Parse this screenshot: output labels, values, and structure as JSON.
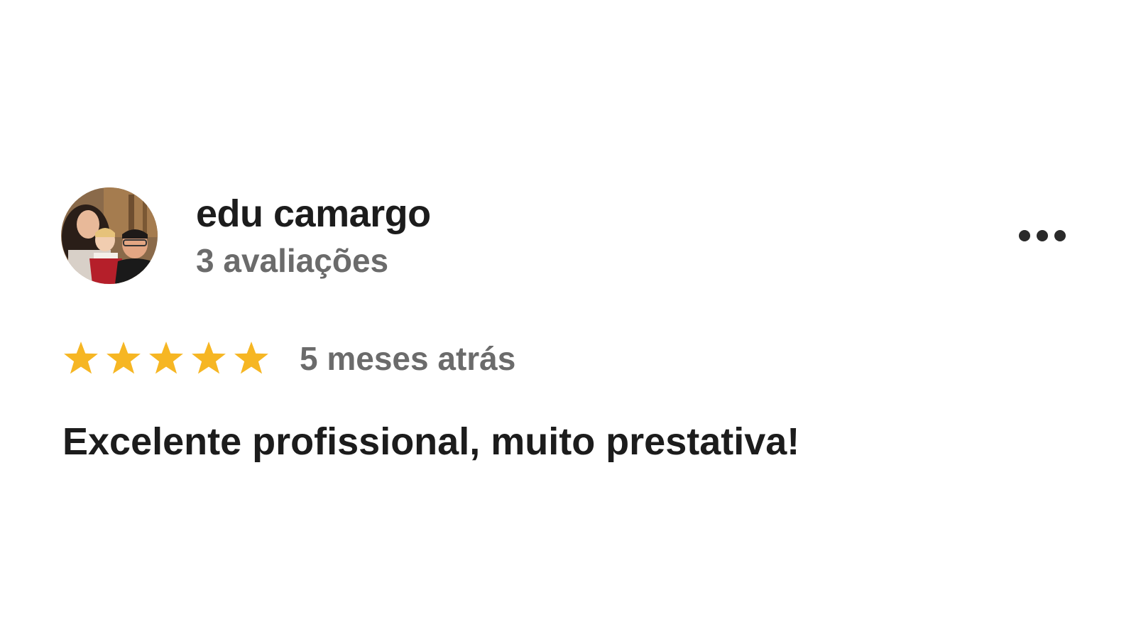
{
  "review": {
    "reviewer_name": "edu camargo",
    "review_count": "3 avaliações",
    "avatar_icon": "avatar-photo",
    "more_icon": "more-horizontal-icon",
    "rating": 5,
    "rating_max": 5,
    "date": "5 meses atrás",
    "text": "Excelente profissional, muito prestativa!"
  },
  "colors": {
    "star": "#F6B623",
    "name": "#1C1C1C",
    "secondary": "#6B6B6B",
    "background": "#FFFFFF"
  }
}
